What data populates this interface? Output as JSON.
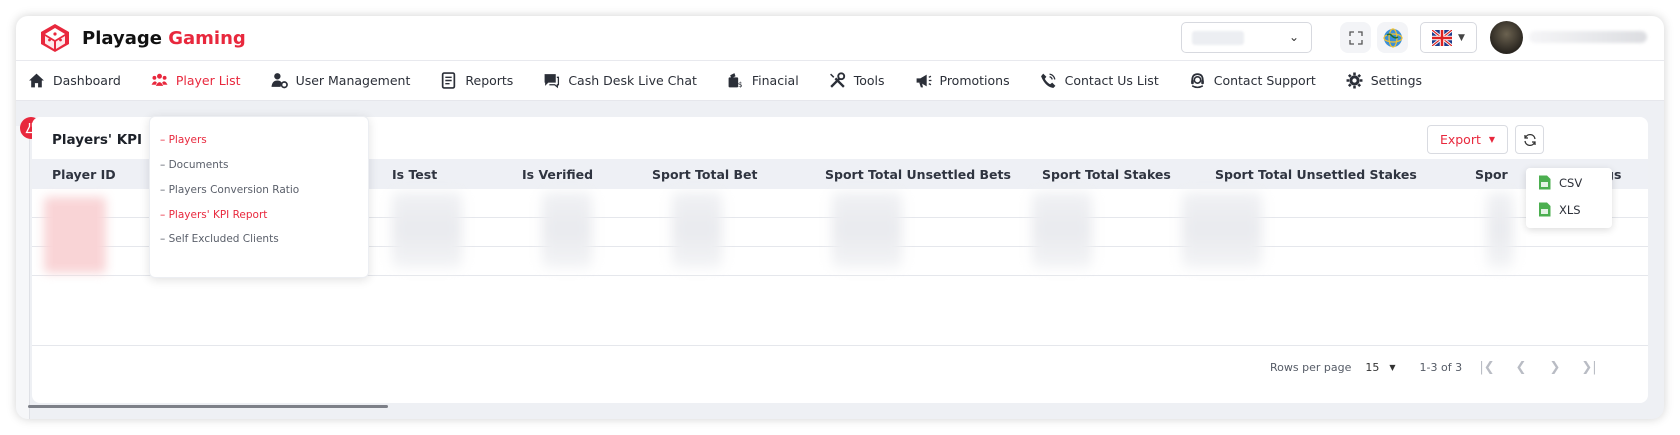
{
  "brand": {
    "name": "Playage",
    "accent_name": "Gaming",
    "accent_color": "#e8283d"
  },
  "nav": [
    {
      "label": "Dashboard",
      "icon": "home-icon"
    },
    {
      "label": "Player List",
      "icon": "users-icon",
      "active": true
    },
    {
      "label": "User Management",
      "icon": "user-gear-icon"
    },
    {
      "label": "Reports",
      "icon": "report-icon"
    },
    {
      "label": "Cash Desk Live Chat",
      "icon": "chat-icon"
    },
    {
      "label": "Finacial",
      "icon": "money-icon"
    },
    {
      "label": "Tools",
      "icon": "tools-icon"
    },
    {
      "label": "Promotions",
      "icon": "megaphone-icon"
    },
    {
      "label": "Contact Us List",
      "icon": "phone-icon"
    },
    {
      "label": "Contact Support",
      "icon": "headset-icon"
    },
    {
      "label": "Settings",
      "icon": "gear-icon"
    }
  ],
  "player_list_menu": [
    {
      "label": "– Players",
      "active": true
    },
    {
      "label": "– Documents",
      "active": false
    },
    {
      "label": "– Players Conversion Ratio",
      "active": false
    },
    {
      "label": "– Players' KPI Report",
      "active": true
    },
    {
      "label": "– Self Excluded Clients",
      "active": false
    }
  ],
  "card": {
    "title": "Players' KPI"
  },
  "export": {
    "label": "Export",
    "options": [
      "CSV",
      "XLS"
    ]
  },
  "table": {
    "columns": [
      "Player ID",
      "Is Test",
      "Is Verified",
      "Sport Total Bet",
      "Sport Total Unsettled Bets",
      "Sport Total Stakes",
      "Sport Total Unsettled Stakes",
      "Spor",
      "gs"
    ],
    "cells": [
      "-"
    ]
  },
  "pagination": {
    "rows_per_page_label": "Rows per page",
    "rows_per_page_value": "15",
    "range": "1-3 of 3"
  }
}
